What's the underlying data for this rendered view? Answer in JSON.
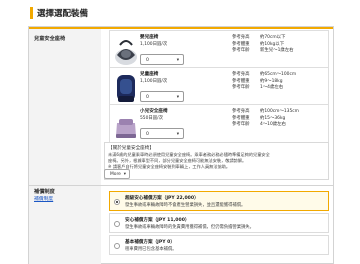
{
  "page": {
    "title": "選擇選配裝備"
  },
  "child_seat": {
    "label": "兒童安全座椅",
    "items": [
      {
        "name": "嬰兒座椅",
        "price": "1,100日圓/次",
        "select_value": "0",
        "specs": [
          {
            "label": "參考身高",
            "value": "約70cm以下"
          },
          {
            "label": "參考體重",
            "value": "約10kg以下"
          },
          {
            "label": "參考年齡",
            "value": "新生兒～1歲左右"
          }
        ]
      },
      {
        "name": "兒童座椅",
        "price": "1,100日圓/次",
        "select_value": "0",
        "specs": [
          {
            "label": "參考身高",
            "value": "約65cm～100cm"
          },
          {
            "label": "參考體重",
            "value": "約9～18kg"
          },
          {
            "label": "參考年齡",
            "value": "1～4歲左右"
          }
        ]
      },
      {
        "name": "小兒安全座椅",
        "price": "550日圓/次",
        "select_value": "0",
        "specs": [
          {
            "label": "參考身高",
            "value": "約100cm～135cm"
          },
          {
            "label": "參考體重",
            "value": "約15～36kg"
          },
          {
            "label": "參考年齡",
            "value": "4～10歲左右"
          }
        ]
      }
    ],
    "note": {
      "title": "【關於兒童安全座椅】",
      "lines": [
        "未滿6歲的兒童乘車時必須使用兒童安全座椅。乘車者務必務必隨時準備足夠的兒童安全",
        "座椅。另外，根據車型不同，部分兒童安全座椅可能無法安裝，敬請諒解。",
        "※ 請客戶自行將兒童安全座椅安裝到車輛上，工作人員無法協助。"
      ],
      "more_label": "More",
      "more_chevron": "▾"
    },
    "select_chevron": "▾"
  },
  "insurance": {
    "label": "補償制度",
    "link": "補償制度",
    "options": [
      {
        "name": "超級安心補償方案（JPY 22,000）",
        "desc": "發生事故或車輛故障時不會產生營業損失，並且還能獲得補償。",
        "selected": true
      },
      {
        "name": "安心補償方案（JPY 11,000）",
        "desc": "發生事故或車輛故障時的免責費用獲得補償，但仍需負擔營業損失。",
        "selected": false
      },
      {
        "name": "基本補償方案（JPY 0）",
        "desc": "租車費用已包含基本補償。",
        "selected": false
      }
    ]
  },
  "colors": {
    "accent": "#f2a900",
    "link": "#1a56c4",
    "selected_bg": "#fffbe9"
  },
  "icons": {
    "seat1": "infant-seat-icon",
    "seat2": "child-seat-icon",
    "seat3": "booster-seat-icon"
  }
}
